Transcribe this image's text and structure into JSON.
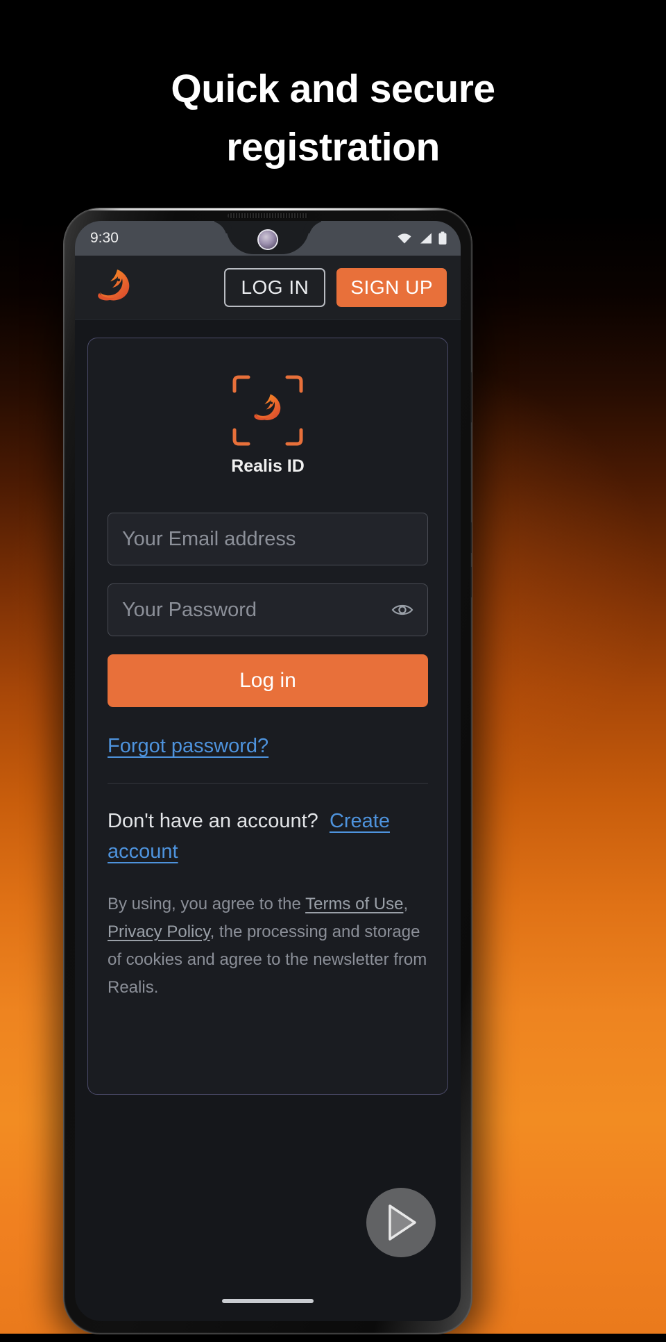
{
  "promo": {
    "headline_line1": "Quick and secure",
    "headline_line2": "registration",
    "background_top_color": "#000000",
    "background_bottom_color": "#f08020"
  },
  "phone": {
    "statusbar": {
      "clock": "9:30",
      "icons": [
        "wifi-icon",
        "cellular-signal-icon",
        "battery-icon"
      ]
    }
  },
  "app": {
    "header": {
      "logo_name": "realis-phoenix-logo",
      "login_label": "LOG IN",
      "signup_label": "SIGN UP",
      "accent_color": "#e8703a"
    },
    "card": {
      "logo_name": "realis-id-scan-logo",
      "brand_name": "Realis ID",
      "email_field": {
        "value": "",
        "placeholder": "Your Email address"
      },
      "password_field": {
        "value": "",
        "placeholder": "Your Password",
        "toggle_icon": "eye-icon"
      },
      "primary_button_label": "Log in",
      "forgot_password_label": "Forgot password?",
      "account_prompt": "Don't have an account?",
      "create_account_label": "Create account",
      "legal": {
        "part1": "By using, you agree to the ",
        "terms_label": "Terms of Use",
        "part2": ", ",
        "privacy_label": "Privacy Policy",
        "part3": ", the processing and storage of cookies and agree to the newsletter from Realis."
      },
      "link_color": "#4e93dd"
    },
    "fab": {
      "name": "google-play-button"
    }
  }
}
